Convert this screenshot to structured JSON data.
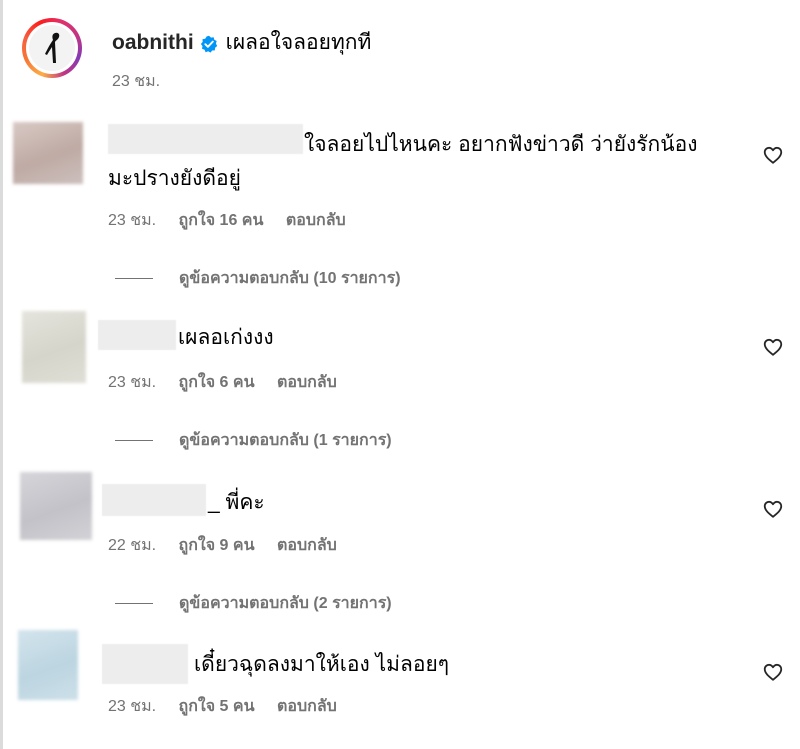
{
  "post": {
    "username": "oabnithi",
    "caption": "เผลอใจลอยทุกที",
    "time": "23 ชม."
  },
  "icons": {
    "verified": "verified-badge-icon",
    "heart": "heart-outline-icon"
  },
  "colors": {
    "verified_blue": "#0095f6",
    "meta_gray": "#737373"
  },
  "comments": [
    {
      "text_line1": "ใจลอยไปไหนคะ อยากฟังข่าวดี ว่ายังรักน้อง",
      "text_line2": "มะปรางยังดีอยู่",
      "time": "23 ชม.",
      "likes": "ถูกใจ 16 คน",
      "reply": "ตอบกลับ",
      "view_replies": "ดูข้อความตอบกลับ (10 รายการ)"
    },
    {
      "text_line1": "เผลอเก่งงง",
      "time": "23 ชม.",
      "likes": "ถูกใจ 6 คน",
      "reply": "ตอบกลับ",
      "view_replies": "ดูข้อความตอบกลับ (1 รายการ)"
    },
    {
      "text_line1": "_ พี่คะ",
      "time": "22 ชม.",
      "likes": "ถูกใจ 9 คน",
      "reply": "ตอบกลับ",
      "view_replies": "ดูข้อความตอบกลับ (2 รายการ)"
    },
    {
      "text_line1": "เดี๋ยวฉุดลงมาให้เอง ไม่ลอยๆ",
      "time": "23 ชม.",
      "likes": "ถูกใจ 5 คน",
      "reply": "ตอบกลับ"
    }
  ]
}
